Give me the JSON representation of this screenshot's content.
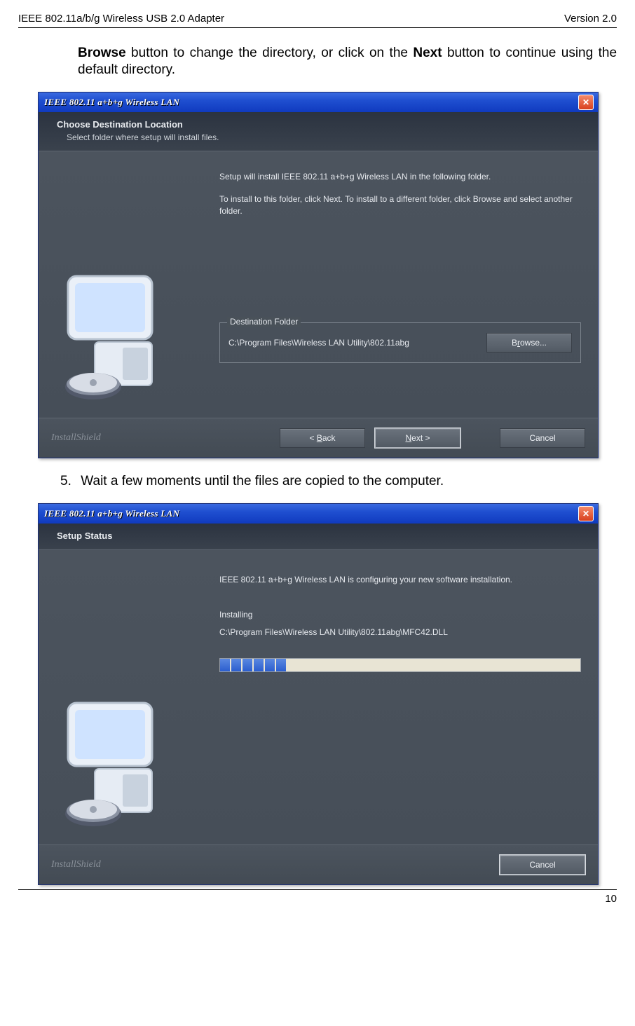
{
  "header": {
    "left": "IEEE 802.11a/b/g Wireless USB 2.0 Adapter",
    "right": "Version 2.0"
  },
  "para_pre": "Browse",
  "para_mid": " button to change the directory, or click on the ",
  "para_bold2": "Next",
  "para_post": " button to continue using the default directory.",
  "step5_num": "5.",
  "step5_text": "Wait a few moments until the files are copied to the computer.",
  "page_number": "10",
  "win1": {
    "title": "IEEE 802.11 a+b+g Wireless LAN",
    "banner_h": "Choose Destination Location",
    "banner_s": "Select folder where setup will install files.",
    "line1": "Setup will install IEEE 802.11 a+b+g Wireless LAN in the following folder.",
    "line2": "To install to this folder, click Next. To install to a different folder, click Browse and select another folder.",
    "dest_legend": "Destination Folder",
    "dest_path": "C:\\Program Files\\Wireless LAN Utility\\802.11abg",
    "browse_pre": "B",
    "browse_ul": "r",
    "browse_post": "owse...",
    "back_pre": "< ",
    "back_ul": "B",
    "back_post": "ack",
    "next_ul": "N",
    "next_post": "ext >",
    "cancel": "Cancel",
    "brand": "InstallShield"
  },
  "win2": {
    "title": "IEEE 802.11 a+b+g Wireless LAN",
    "banner_h": "Setup Status",
    "line1": "IEEE 802.11 a+b+g Wireless LAN is configuring your new software installation.",
    "installing": "Installing",
    "path": "C:\\Program Files\\Wireless LAN Utility\\802.11abg\\MFC42.DLL",
    "cancel": "Cancel",
    "brand": "InstallShield"
  }
}
